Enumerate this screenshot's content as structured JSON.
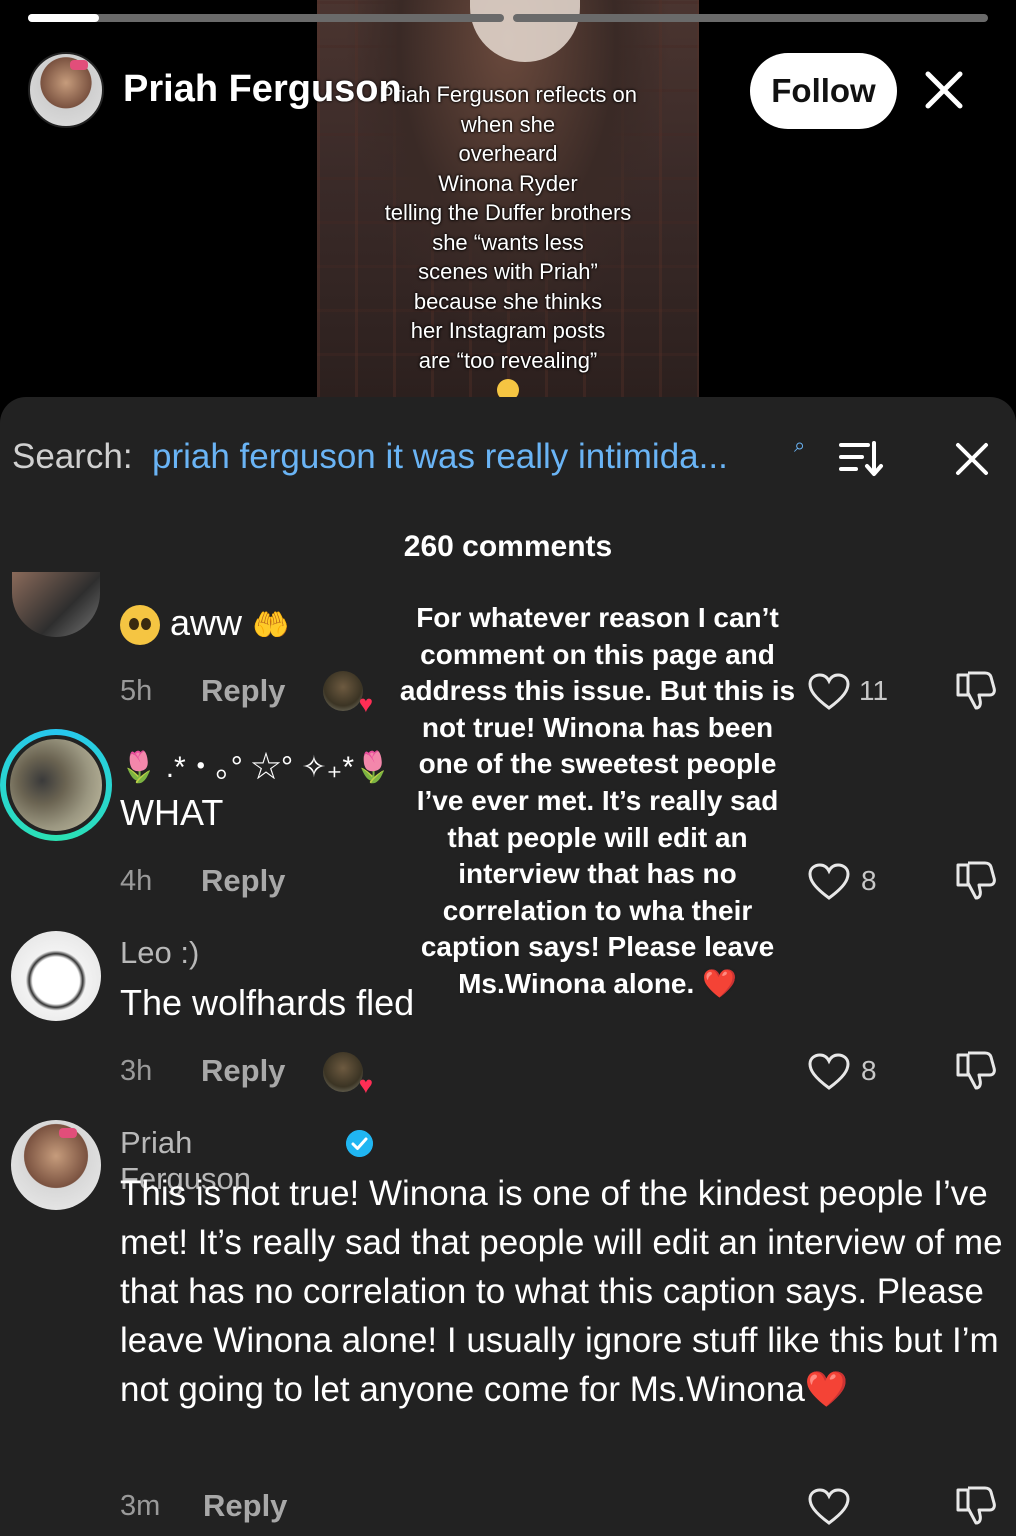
{
  "story": {
    "progress_segments": [
      1.0,
      0.0
    ],
    "first_segment_fill": 0.15,
    "user_name": "Priah Ferguson",
    "follow_label": "Follow",
    "caption_lines": [
      "Priah Ferguson reflects on",
      "when she",
      "overheard",
      "Winona Ryder",
      "telling the Duffer brothers",
      "she “wants less",
      "scenes with Priah”",
      "because she thinks",
      "her Instagram posts",
      "are “too revealing”"
    ]
  },
  "search": {
    "label": "Search:",
    "query": "priah ferguson it was really intimida..."
  },
  "comments_header": "260 comments",
  "comments": [
    {
      "text": "aww",
      "time": "5h",
      "reply_label": "Reply",
      "likes": "11"
    },
    {
      "emoji_line": "🌷 .*・｡° ☆° ✧₊*🌷",
      "text": "WHAT",
      "time": "4h",
      "reply_label": "Reply",
      "likes": "8"
    },
    {
      "username": "Leo :)",
      "text": "The wolfhards fled",
      "time": "3h",
      "reply_label": "Reply",
      "likes": "8"
    },
    {
      "username": "Priah Ferguson",
      "text": "This is not true! Winona is one of the kindest people I’ve met! It’s really sad that people will edit an interview of me that has no correlation to what this caption says. Please leave Winona alone! I usually ignore stuff like this but I’m not going to let anyone come for Ms.Winona❤️",
      "time": "3m",
      "reply_label": "Reply"
    }
  ],
  "overlay_lines": [
    "For whatever reason I can’t",
    "comment on this page and",
    "address this issue. But this is",
    "not true! Winona has been",
    "one of the sweetest people",
    "I’ve ever met. It’s really sad",
    "that people will edit an",
    "interview that has no",
    "correlation to wha their",
    "caption says! Please leave",
    "Ms.Winona alone. ❤️"
  ],
  "icons": {
    "close": "close-icon",
    "sort": "sort-icon",
    "like": "heart-outline-icon",
    "dislike": "thumbs-down-icon",
    "verified": "verified-badge-icon"
  },
  "colors": {
    "sheet_bg": "#222222",
    "link_blue": "#6ab4f5",
    "ring": "#27c7f0",
    "heart_red": "#ff2e55"
  }
}
